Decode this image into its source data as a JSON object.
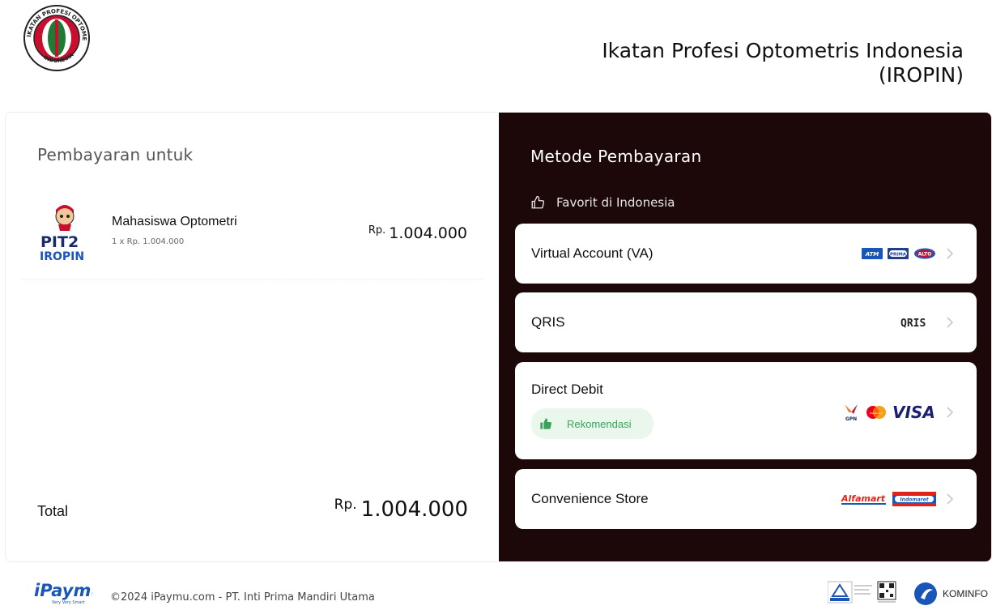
{
  "header": {
    "org_title_line1": "Ikatan Profesi Optometris Indonesia",
    "org_title_line2": "(IROPIN)",
    "logo_text_top": "IKATAN PROFESI OPTOMETRIS",
    "logo_text_bottom": "INDONESIA"
  },
  "left_panel": {
    "heading": "Pembayaran untuk",
    "item": {
      "logo_text_line1": "PIT2",
      "logo_text_line2": "IROPIN",
      "name": "Mahasiswa Optometri",
      "sub": "1 x Rp. 1.004.000",
      "price_currency": "Rp.",
      "price_value": "1.004.000"
    },
    "total_label": "Total",
    "total_currency": "Rp.",
    "total_value": "1.004.000"
  },
  "right_panel": {
    "heading": "Metode Pembayaran",
    "section_label": "Favorit di Indonesia",
    "methods": [
      {
        "label": "Virtual Account (VA)",
        "brands": [
          "ATM",
          "PRIMA",
          "ALTO"
        ]
      },
      {
        "label": "QRIS",
        "brands": [
          "QRIS"
        ]
      },
      {
        "label": "Direct Debit",
        "badge": "Rekomendasi",
        "brands": [
          "GPN",
          "MasterCard",
          "VISA"
        ]
      },
      {
        "label": "Convenience Store",
        "brands": [
          "Alfamart",
          "Indomaret"
        ]
      }
    ]
  },
  "footer": {
    "brand": "iPaymu",
    "brand_tagline": "Very Very Smart",
    "copyright": "©2024 iPaymu.com - PT. Inti Prima Mandiri Utama",
    "kominfo_label": "KOMINFO"
  },
  "colors": {
    "dark_panel": "#1c0808",
    "badge_bg": "#e9f7ec",
    "badge_text": "#3aa35a",
    "ipaymu_blue": "#1a56b8"
  }
}
